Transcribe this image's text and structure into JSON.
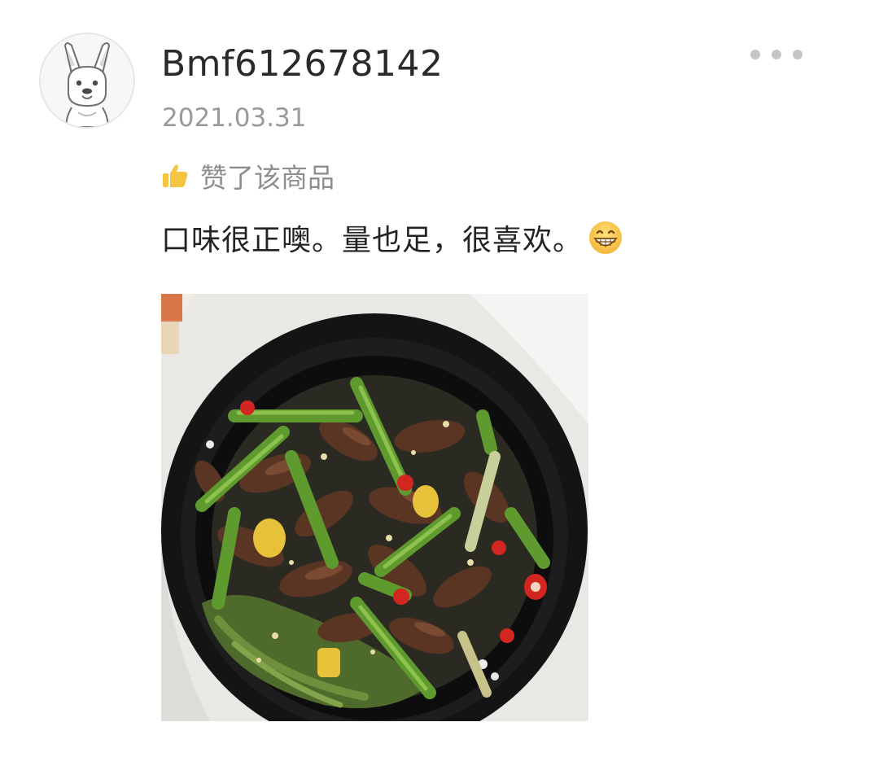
{
  "review": {
    "username": "Bmf612678142",
    "date": "2021.03.31",
    "liked_label": "赞了该商品",
    "text": "口味很正噢。量也足，很喜欢。"
  },
  "icons": {
    "avatar": "kangaroo-avatar-icon",
    "more": "more-dots-icon",
    "like": "thumbs-up-icon",
    "emoji": "grinning-face-icon"
  },
  "colors": {
    "thumb": "#f5c443",
    "muted_text": "#9a9a9a",
    "menu_dots": "#c4c4c4"
  }
}
